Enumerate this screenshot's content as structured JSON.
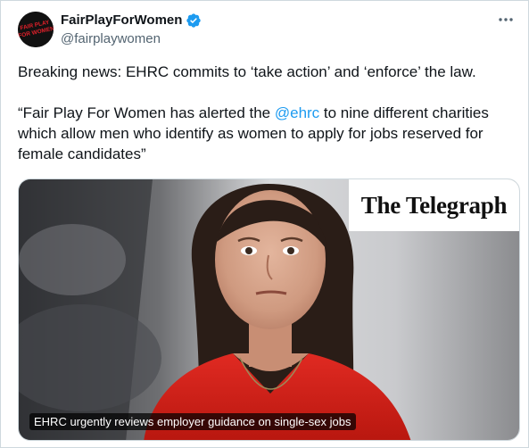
{
  "tweet": {
    "author": {
      "display_name": "FairPlayForWomen",
      "handle": "@fairplaywomen",
      "avatar_text": "FAIR PLAY FOR WOMEN",
      "verified_icon": "verified-badge-icon"
    },
    "more_icon": "more-horizontal-icon",
    "paragraph1": "Breaking news: EHRC commits to ‘take action’ and ‘enforce’ the law.",
    "paragraph2": {
      "before": "“Fair Play For Women has alerted the ",
      "mention": "@ehrc",
      "after": " to nine different charities which allow men who identify as women to apply for jobs reserved for female candidates”"
    },
    "media": {
      "logo": "The Telegraph",
      "caption": "EHRC urgently reviews employer guidance on single-sex jobs"
    }
  },
  "colors": {
    "link": "#1d9bf0",
    "verified": "#1d9bf0",
    "avatar_text": "#e0202a",
    "secondary_text": "#536471",
    "dress": "#d8231c"
  }
}
